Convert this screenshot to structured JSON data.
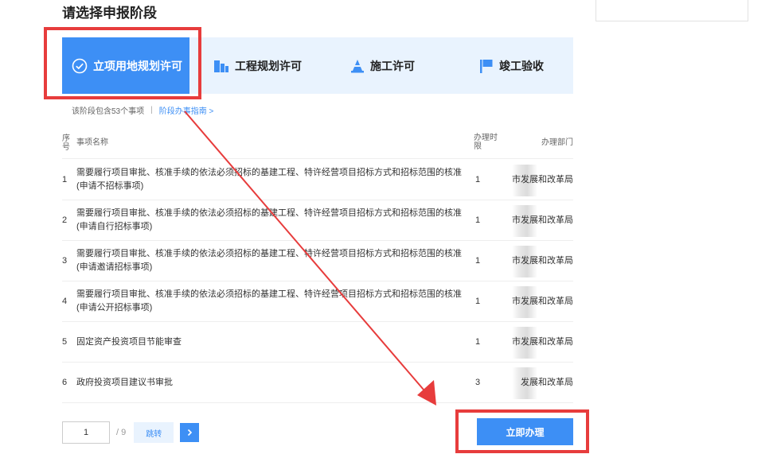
{
  "page": {
    "title": "请选择申报阶段"
  },
  "stages": [
    {
      "label": "立项用地规划许可",
      "icon": "check-circle-icon",
      "active": true
    },
    {
      "label": "工程规划许可",
      "icon": "building-icon",
      "active": false
    },
    {
      "label": "施工许可",
      "icon": "cone-icon",
      "active": false
    },
    {
      "label": "竣工验收",
      "icon": "flag-icon",
      "active": false
    }
  ],
  "stage_info": {
    "count_text": "该阶段包含53个事项",
    "separator": "|",
    "guide_link": "阶段办事指南 >"
  },
  "table": {
    "headers": {
      "seq": "序号",
      "name": "事项名称",
      "time": "办理时限",
      "dept": "办理部门"
    },
    "rows": [
      {
        "idx": "1",
        "name": "需要履行项目审批、核准手续的依法必须招标的基建工程、特许经营项目招标方式和招标范围的核准(申请不招标事项)",
        "time": "1",
        "dept": "市发展和改革局"
      },
      {
        "idx": "2",
        "name": "需要履行项目审批、核准手续的依法必须招标的基建工程、特许经营项目招标方式和招标范围的核准(申请自行招标事项)",
        "time": "1",
        "dept": "市发展和改革局"
      },
      {
        "idx": "3",
        "name": "需要履行项目审批、核准手续的依法必须招标的基建工程、特许经营项目招标方式和招标范围的核准(申请邀请招标事项)",
        "time": "1",
        "dept": "市发展和改革局"
      },
      {
        "idx": "4",
        "name": "需要履行项目审批、核准手续的依法必须招标的基建工程、特许经营项目招标方式和招标范围的核准(申请公开招标事项)",
        "time": "1",
        "dept": "市发展和改革局"
      },
      {
        "idx": "5",
        "name": "固定资产投资项目节能审查",
        "time": "1",
        "dept": "市发展和改革局"
      },
      {
        "idx": "6",
        "name": "政府投资项目建议书审批",
        "time": "3",
        "dept": "发展和改革局"
      }
    ]
  },
  "pagination": {
    "current": "1",
    "total": "/ 9",
    "jump_label": "跳转",
    "next_icon": "chevron-right-icon"
  },
  "actions": {
    "submit_label": "立即办理"
  },
  "colors": {
    "accent": "#3d8ff5",
    "stage_bg": "#e9f3fe",
    "annotation": "#e73c3c"
  }
}
